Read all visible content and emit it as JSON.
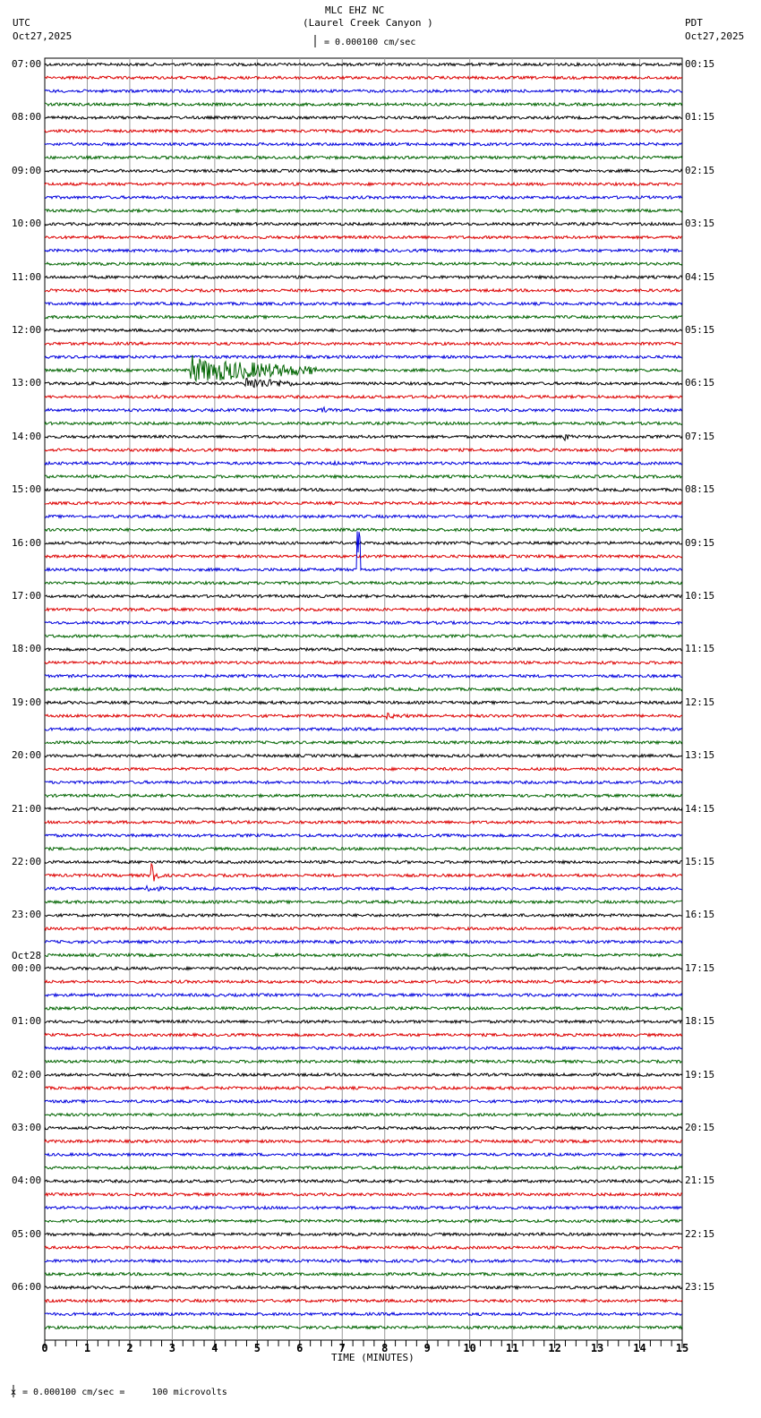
{
  "header": {
    "station": "MLC EHZ NC",
    "location": "(Laurel Creek Canyon )",
    "left_tz": "UTC",
    "left_date": "Oct27,2025",
    "right_tz": "PDT",
    "right_date": "Oct27,2025",
    "scale": "= 0.000100 cm/sec"
  },
  "footer": {
    "scale": "= 0.000100 cm/sec =     100 microvolts",
    "prefix": "x"
  },
  "chart_data": {
    "type": "line",
    "title": "MLC EHZ NC (Laurel Creek Canyon )",
    "xlabel": "TIME (MINUTES)",
    "xlim": [
      0,
      15
    ],
    "x_ticks": [
      "0",
      "1",
      "2",
      "3",
      "4",
      "5",
      "6",
      "7",
      "8",
      "9",
      "10",
      "11",
      "12",
      "13",
      "14",
      "15"
    ],
    "traces_per_hour": 4,
    "trace_colors": [
      "#000000",
      "#dd0000",
      "#0000dd",
      "#006400"
    ],
    "left_labels": [
      "07:00",
      "08:00",
      "09:00",
      "10:00",
      "11:00",
      "12:00",
      "13:00",
      "14:00",
      "15:00",
      "16:00",
      "17:00",
      "18:00",
      "19:00",
      "20:00",
      "21:00",
      "22:00",
      "23:00",
      "00:00",
      "01:00",
      "02:00",
      "03:00",
      "04:00",
      "05:00",
      "06:00"
    ],
    "date_change": {
      "hour_index": 17,
      "label": "Oct28"
    },
    "right_labels": [
      "00:15",
      "01:15",
      "02:15",
      "03:15",
      "04:15",
      "05:15",
      "06:15",
      "07:15",
      "08:15",
      "09:15",
      "10:15",
      "11:15",
      "12:15",
      "13:15",
      "14:15",
      "15:15",
      "16:15",
      "17:15",
      "18:15",
      "19:15",
      "20:15",
      "21:15",
      "22:15",
      "23:15"
    ],
    "events": [
      {
        "trace": 23,
        "start": 3.4,
        "end": 6.4,
        "amp": 14,
        "spike": 22
      },
      {
        "trace": 24,
        "start": 4.7,
        "end": 6.0,
        "amp": 7,
        "spike": 8
      },
      {
        "trace": 26,
        "start": 6.5,
        "end": 6.9,
        "amp": 3,
        "spike": 4
      },
      {
        "trace": 28,
        "start": 12.2,
        "end": 12.5,
        "amp": 4,
        "spike": 6
      },
      {
        "trace": 30,
        "start": 6.8,
        "end": 10.0,
        "amp": 2,
        "spike": 3
      },
      {
        "trace": 38,
        "start": 7.35,
        "end": 7.5,
        "amp": 6,
        "spike": 50
      },
      {
        "trace": 49,
        "start": 8.0,
        "end": 9.0,
        "amp": 3,
        "spike": 4
      },
      {
        "trace": 61,
        "start": 2.5,
        "end": 2.8,
        "amp": 6,
        "spike": 55
      },
      {
        "trace": 62,
        "start": 2.4,
        "end": 2.9,
        "amp": 4,
        "spike": 6
      }
    ]
  }
}
